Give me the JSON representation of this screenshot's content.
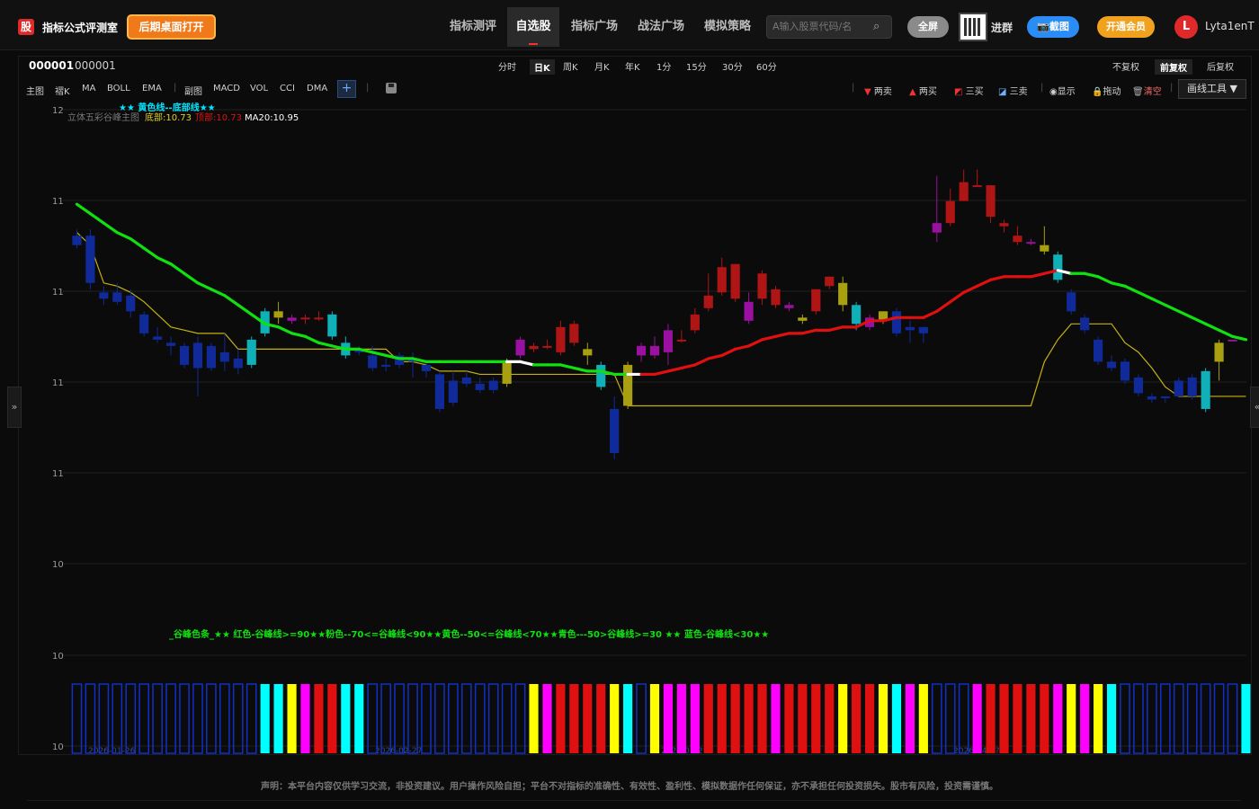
{
  "header": {
    "logo_badge": "股",
    "app_title": "指标公式评测室",
    "desktop_button": "后期桌面打开",
    "nav": [
      "指标测评",
      "自选股",
      "指标广场",
      "战法广场",
      "模拟策略"
    ],
    "active_nav": "自选股",
    "search_placeholder": "A输入股票代码/名",
    "fullscreen_button": "全屏",
    "join_group": "进群",
    "screenshot_button": "截图",
    "vip_button": "开通会员",
    "avatar_letter": "L",
    "username": "Lyta1enT",
    "colors": {
      "fullscreen": "#888888",
      "screenshot": "#2a8cf5",
      "vip": "#f0a21e",
      "avatar": "#e02a2a"
    }
  },
  "stock": {
    "code": "000001",
    "name": "000001"
  },
  "periods": [
    "分时",
    "日K",
    "周K",
    "月K",
    "年K",
    "1分",
    "15分",
    "30分",
    "60分"
  ],
  "active_period": "日K",
  "adjust": [
    "不复权",
    "前复权",
    "后复权"
  ],
  "active_adjust": "前复权",
  "indicator_bar": [
    "主图",
    "褶K",
    "MA",
    "BOLL",
    "EMA",
    "副图",
    "MACD",
    "VOL",
    "CCI",
    "DMA"
  ],
  "tools": {
    "two_sell": "两卖",
    "two_buy": "两买",
    "three_buy": "三买",
    "three_sell": "三卖",
    "show": "显示",
    "drag": "拖动",
    "clear": "清空",
    "draw_tools": "画线工具 ▼"
  },
  "chart_data": {
    "type": "candlestick",
    "y_tick_labels": [
      "12",
      "11",
      "11",
      "11",
      "11",
      "10",
      "10",
      "10"
    ],
    "legend_top": "★★ 黄色线--底部线★★",
    "legend_series": {
      "name": "立体五彩谷峰主图",
      "bottom": "底部:10.73",
      "top": "顶部:10.73",
      "ma20": "MA20:10.95"
    },
    "band_caption": "_谷峰色条_★★ 红色-谷峰线>=90★★粉色--70<=谷峰线<90★★黄色--50<=谷峰线<70★★青色---50>谷峰线>=30 ★★ 蓝色-谷峰线<30★★",
    "x_date_labels": [
      "2026-01-26",
      "2026-02-27",
      "2026-03-2?",
      "2026-04-2?"
    ],
    "ylim": [
      9.98,
      12.0
    ],
    "candles": [
      {
        "o": 11.6,
        "h": 11.62,
        "l": 11.56,
        "c": 11.57,
        "col": "blue"
      },
      {
        "o": 11.6,
        "h": 11.62,
        "l": 11.43,
        "c": 11.45,
        "col": "blue"
      },
      {
        "o": 11.42,
        "h": 11.44,
        "l": 11.38,
        "c": 11.4,
        "col": "blue"
      },
      {
        "o": 11.42,
        "h": 11.45,
        "l": 11.38,
        "c": 11.39,
        "col": "blue"
      },
      {
        "o": 11.41,
        "h": 11.43,
        "l": 11.34,
        "c": 11.36,
        "col": "blue"
      },
      {
        "o": 11.35,
        "h": 11.36,
        "l": 11.28,
        "c": 11.29,
        "col": "blue"
      },
      {
        "o": 11.28,
        "h": 11.31,
        "l": 11.26,
        "c": 11.27,
        "col": "blue"
      },
      {
        "o": 11.26,
        "h": 11.28,
        "l": 11.22,
        "c": 11.25,
        "col": "blue"
      },
      {
        "o": 11.25,
        "h": 11.26,
        "l": 11.18,
        "c": 11.19,
        "col": "blue"
      },
      {
        "o": 11.26,
        "h": 11.28,
        "l": 11.09,
        "c": 11.18,
        "col": "blue"
      },
      {
        "o": 11.25,
        "h": 11.26,
        "l": 11.17,
        "c": 11.18,
        "col": "blue"
      },
      {
        "o": 11.23,
        "h": 11.29,
        "l": 11.17,
        "c": 11.2,
        "col": "blue"
      },
      {
        "o": 11.21,
        "h": 11.24,
        "l": 11.16,
        "c": 11.18,
        "col": "blue"
      },
      {
        "o": 11.19,
        "h": 11.28,
        "l": 11.18,
        "c": 11.27,
        "col": "cyan"
      },
      {
        "o": 11.29,
        "h": 11.37,
        "l": 11.28,
        "c": 11.36,
        "col": "cyan"
      },
      {
        "o": 11.34,
        "h": 11.39,
        "l": 11.32,
        "c": 11.36,
        "col": "yellow"
      },
      {
        "o": 11.34,
        "h": 11.35,
        "l": 11.32,
        "c": 11.33,
        "col": "pink"
      },
      {
        "o": 11.34,
        "h": 11.35,
        "l": 11.32,
        "c": 11.34,
        "col": "red"
      },
      {
        "o": 11.34,
        "h": 11.36,
        "l": 11.33,
        "c": 11.34,
        "col": "red"
      },
      {
        "o": 11.35,
        "h": 11.36,
        "l": 11.27,
        "c": 11.28,
        "col": "cyan"
      },
      {
        "o": 11.26,
        "h": 11.28,
        "l": 11.21,
        "c": 11.22,
        "col": "cyan"
      },
      {
        "o": 11.24,
        "h": 11.25,
        "l": 11.22,
        "c": 11.23,
        "col": "blue"
      },
      {
        "o": 11.22,
        "h": 11.25,
        "l": 11.17,
        "c": 11.18,
        "col": "blue"
      },
      {
        "o": 11.19,
        "h": 11.21,
        "l": 11.17,
        "c": 11.19,
        "col": "blue"
      },
      {
        "o": 11.22,
        "h": 11.23,
        "l": 11.18,
        "c": 11.19,
        "col": "blue"
      },
      {
        "o": 11.2,
        "h": 11.23,
        "l": 11.15,
        "c": 11.21,
        "col": "blue"
      },
      {
        "o": 11.19,
        "h": 11.2,
        "l": 11.15,
        "c": 11.17,
        "col": "blue"
      },
      {
        "o": 11.16,
        "h": 11.17,
        "l": 11.04,
        "c": 11.05,
        "col": "blue"
      },
      {
        "o": 11.14,
        "h": 11.17,
        "l": 11.06,
        "c": 11.07,
        "col": "blue"
      },
      {
        "o": 11.15,
        "h": 11.17,
        "l": 11.12,
        "c": 11.13,
        "col": "blue"
      },
      {
        "o": 11.13,
        "h": 11.15,
        "l": 11.1,
        "c": 11.11,
        "col": "blue"
      },
      {
        "o": 11.11,
        "h": 11.15,
        "l": 11.1,
        "c": 11.14,
        "col": "blue"
      },
      {
        "o": 11.13,
        "h": 11.21,
        "l": 11.12,
        "c": 11.2,
        "col": "yellow"
      },
      {
        "o": 11.22,
        "h": 11.28,
        "l": 11.21,
        "c": 11.27,
        "col": "pink"
      },
      {
        "o": 11.24,
        "h": 11.26,
        "l": 11.23,
        "c": 11.25,
        "col": "red"
      },
      {
        "o": 11.25,
        "h": 11.27,
        "l": 11.24,
        "c": 11.25,
        "col": "red"
      },
      {
        "o": 11.23,
        "h": 11.33,
        "l": 11.22,
        "c": 11.31,
        "col": "red"
      },
      {
        "o": 11.26,
        "h": 11.33,
        "l": 11.25,
        "c": 11.32,
        "col": "red"
      },
      {
        "o": 11.22,
        "h": 11.26,
        "l": 11.19,
        "c": 11.24,
        "col": "yellow"
      },
      {
        "o": 11.19,
        "h": 11.2,
        "l": 11.11,
        "c": 11.12,
        "col": "cyan"
      },
      {
        "o": 11.05,
        "h": 11.09,
        "l": 10.89,
        "c": 10.91,
        "col": "blue"
      },
      {
        "o": 11.06,
        "h": 11.2,
        "l": 11.05,
        "c": 11.19,
        "col": "yellow"
      },
      {
        "o": 11.22,
        "h": 11.26,
        "l": 11.2,
        "c": 11.25,
        "col": "pink"
      },
      {
        "o": 11.22,
        "h": 11.28,
        "l": 11.21,
        "c": 11.25,
        "col": "pink"
      },
      {
        "o": 11.23,
        "h": 11.32,
        "l": 11.19,
        "c": 11.3,
        "col": "pink"
      },
      {
        "o": 11.27,
        "h": 11.3,
        "l": 11.26,
        "c": 11.27,
        "col": "red"
      },
      {
        "o": 11.3,
        "h": 11.37,
        "l": 11.29,
        "c": 11.35,
        "col": "red"
      },
      {
        "o": 11.37,
        "h": 11.48,
        "l": 11.36,
        "c": 11.41,
        "col": "red"
      },
      {
        "o": 11.42,
        "h": 11.53,
        "l": 11.41,
        "c": 11.5,
        "col": "red"
      },
      {
        "o": 11.4,
        "h": 11.51,
        "l": 11.39,
        "c": 11.51,
        "col": "red"
      },
      {
        "o": 11.33,
        "h": 11.42,
        "l": 11.32,
        "c": 11.39,
        "col": "pink"
      },
      {
        "o": 11.4,
        "h": 11.49,
        "l": 11.38,
        "c": 11.48,
        "col": "red"
      },
      {
        "o": 11.38,
        "h": 11.44,
        "l": 11.37,
        "c": 11.43,
        "col": "red"
      },
      {
        "o": 11.38,
        "h": 11.39,
        "l": 11.36,
        "c": 11.37,
        "col": "pink"
      },
      {
        "o": 11.34,
        "h": 11.35,
        "l": 11.32,
        "c": 11.33,
        "col": "yellow"
      },
      {
        "o": 11.36,
        "h": 11.43,
        "l": 11.35,
        "c": 11.43,
        "col": "red"
      },
      {
        "o": 11.44,
        "h": 11.47,
        "l": 11.43,
        "c": 11.47,
        "col": "red"
      },
      {
        "o": 11.45,
        "h": 11.47,
        "l": 11.36,
        "c": 11.38,
        "col": "yellow"
      },
      {
        "o": 11.38,
        "h": 11.39,
        "l": 11.3,
        "c": 11.32,
        "col": "cyan"
      },
      {
        "o": 11.31,
        "h": 11.35,
        "l": 11.3,
        "c": 11.34,
        "col": "pink"
      },
      {
        "o": 11.33,
        "h": 11.36,
        "l": 11.32,
        "c": 11.36,
        "col": "yellow"
      },
      {
        "o": 11.36,
        "h": 11.37,
        "l": 11.28,
        "c": 11.29,
        "col": "blue"
      },
      {
        "o": 11.31,
        "h": 11.33,
        "l": 11.26,
        "c": 11.3,
        "col": "blue"
      },
      {
        "o": 11.31,
        "h": 11.31,
        "l": 11.26,
        "c": 11.29,
        "col": "blue"
      },
      {
        "o": 11.64,
        "h": 11.79,
        "l": 11.58,
        "c": 11.61,
        "col": "pink"
      },
      {
        "o": 11.71,
        "h": 11.75,
        "l": 11.63,
        "c": 11.64,
        "col": "red"
      },
      {
        "o": 11.77,
        "h": 11.81,
        "l": 11.71,
        "c": 11.71,
        "col": "red"
      },
      {
        "o": 11.76,
        "h": 11.81,
        "l": 11.76,
        "c": 11.76,
        "col": "red"
      },
      {
        "o": 11.76,
        "h": 11.76,
        "l": 11.64,
        "c": 11.66,
        "col": "red"
      },
      {
        "o": 11.63,
        "h": 11.65,
        "l": 11.61,
        "c": 11.64,
        "col": "red"
      },
      {
        "o": 11.6,
        "h": 11.63,
        "l": 11.57,
        "c": 11.58,
        "col": "red"
      },
      {
        "o": 11.58,
        "h": 11.59,
        "l": 11.57,
        "c": 11.58,
        "col": "pink"
      },
      {
        "o": 11.55,
        "h": 11.63,
        "l": 11.54,
        "c": 11.57,
        "col": "yellow"
      },
      {
        "o": 11.54,
        "h": 11.55,
        "l": 11.45,
        "c": 11.46,
        "col": "cyan"
      },
      {
        "o": 11.42,
        "h": 11.43,
        "l": 11.35,
        "c": 11.36,
        "col": "blue"
      },
      {
        "o": 11.34,
        "h": 11.35,
        "l": 11.29,
        "c": 11.3,
        "col": "blue"
      },
      {
        "o": 11.27,
        "h": 11.28,
        "l": 11.19,
        "c": 11.2,
        "col": "blue"
      },
      {
        "o": 11.2,
        "h": 11.22,
        "l": 11.17,
        "c": 11.18,
        "col": "blue"
      },
      {
        "o": 11.2,
        "h": 11.21,
        "l": 11.13,
        "c": 11.14,
        "col": "blue"
      },
      {
        "o": 11.15,
        "h": 11.16,
        "l": 11.09,
        "c": 11.1,
        "col": "blue"
      },
      {
        "o": 11.09,
        "h": 11.1,
        "l": 11.07,
        "c": 11.08,
        "col": "blue"
      },
      {
        "o": 11.09,
        "h": 11.09,
        "l": 11.07,
        "c": 11.09,
        "col": "blue"
      },
      {
        "o": 11.14,
        "h": 11.15,
        "l": 11.09,
        "c": 11.09,
        "col": "blue"
      },
      {
        "o": 11.15,
        "h": 11.16,
        "l": 11.08,
        "c": 11.09,
        "col": "blue"
      },
      {
        "o": 11.05,
        "h": 11.18,
        "l": 11.04,
        "c": 11.17,
        "col": "cyan"
      },
      {
        "o": 11.2,
        "h": 11.27,
        "l": 11.14,
        "c": 11.26,
        "col": "yellow"
      },
      {
        "o": 11.27,
        "h": 11.27,
        "l": 11.27,
        "c": 11.27,
        "col": "pink"
      }
    ],
    "ma20_curve": [
      11.7,
      11.67,
      11.64,
      11.61,
      11.59,
      11.56,
      11.53,
      11.51,
      11.48,
      11.45,
      11.43,
      11.41,
      11.38,
      11.35,
      11.32,
      11.31,
      11.29,
      11.28,
      11.26,
      11.25,
      11.24,
      11.24,
      11.23,
      11.22,
      11.21,
      11.21,
      11.2,
      11.2,
      11.2,
      11.2,
      11.2,
      11.2,
      11.2,
      11.2,
      11.19,
      11.19,
      11.19,
      11.18,
      11.17,
      11.17,
      11.16,
      11.16,
      11.16,
      11.16,
      11.17,
      11.18,
      11.19,
      11.21,
      11.22,
      11.24,
      11.25,
      11.27,
      11.28,
      11.29,
      11.29,
      11.3,
      11.3,
      11.31,
      11.31,
      11.33,
      11.33,
      11.34,
      11.34,
      11.34,
      11.36,
      11.39,
      11.42,
      11.44,
      11.46,
      11.47,
      11.47,
      11.47,
      11.48,
      11.49,
      11.48,
      11.48,
      11.47,
      11.45,
      11.44,
      11.42,
      11.4,
      11.38,
      11.36,
      11.34,
      11.32,
      11.3,
      11.28,
      11.27
    ],
    "ma20_colors": [
      "green",
      "green",
      "green",
      "green",
      "green",
      "green",
      "green",
      "green",
      "green",
      "green",
      "green",
      "green",
      "green",
      "green",
      "green",
      "green",
      "green",
      "green",
      "green",
      "green",
      "green",
      "green",
      "green",
      "green",
      "green",
      "green",
      "green",
      "green",
      "green",
      "green",
      "green",
      "green",
      "white",
      "white",
      "green",
      "green",
      "green",
      "green",
      "green",
      "green",
      "green",
      "white",
      "red",
      "red",
      "red",
      "red",
      "red",
      "red",
      "red",
      "red",
      "red",
      "red",
      "red",
      "red",
      "red",
      "red",
      "red",
      "red",
      "red",
      "red",
      "red",
      "red",
      "red",
      "red",
      "red",
      "red",
      "red",
      "red",
      "red",
      "red",
      "red",
      "red",
      "red",
      "white",
      "green",
      "green",
      "green",
      "green",
      "green",
      "green",
      "green",
      "green",
      "green",
      "green",
      "green",
      "green",
      "green",
      "green"
    ],
    "bottom_line": [
      11.61,
      11.57,
      11.45,
      11.44,
      11.42,
      11.39,
      11.35,
      11.31,
      11.3,
      11.29,
      11.29,
      11.29,
      11.24,
      11.24,
      11.24,
      11.24,
      11.24,
      11.24,
      11.24,
      11.24,
      11.24,
      11.24,
      11.24,
      11.24,
      11.2,
      11.2,
      11.19,
      11.17,
      11.17,
      11.17,
      11.16,
      11.16,
      11.16,
      11.16,
      11.16,
      11.16,
      11.16,
      11.16,
      11.16,
      11.16,
      11.16,
      11.06,
      11.06,
      11.06,
      11.06,
      11.06,
      11.06,
      11.06,
      11.06,
      11.06,
      11.06,
      11.06,
      11.06,
      11.06,
      11.06,
      11.06,
      11.06,
      11.06,
      11.06,
      11.06,
      11.06,
      11.06,
      11.06,
      11.06,
      11.06,
      11.06,
      11.06,
      11.06,
      11.06,
      11.06,
      11.06,
      11.06,
      11.2,
      11.27,
      11.32,
      11.32,
      11.32,
      11.32,
      11.26,
      11.23,
      11.18,
      11.12,
      11.09,
      11.09,
      11.09,
      11.09,
      11.09,
      11.09
    ],
    "color_band": [
      "blue",
      "blue",
      "blue",
      "blue",
      "blue",
      "blue",
      "blue",
      "blue",
      "blue",
      "blue",
      "blue",
      "blue",
      "blue",
      "blue",
      "cyan",
      "cyan",
      "yellow",
      "pink",
      "red",
      "red",
      "cyan",
      "cyan",
      "blue",
      "blue",
      "blue",
      "blue",
      "blue",
      "blue",
      "blue",
      "blue",
      "blue",
      "blue",
      "blue",
      "blue",
      "yellow",
      "pink",
      "red",
      "red",
      "red",
      "red",
      "yellow",
      "cyan",
      "blue",
      "yellow",
      "pink",
      "pink",
      "pink",
      "red",
      "red",
      "red",
      "red",
      "red",
      "pink",
      "red",
      "red",
      "red",
      "red",
      "yellow",
      "red",
      "red",
      "yellow",
      "cyan",
      "pink",
      "yellow",
      "blue",
      "blue",
      "blue",
      "pink",
      "red",
      "red",
      "red",
      "red",
      "red",
      "pink",
      "yellow",
      "pink",
      "yellow",
      "cyan",
      "blue",
      "blue",
      "blue",
      "blue",
      "blue",
      "blue",
      "blue",
      "blue",
      "blue",
      "cyan",
      "yellow",
      "pink"
    ],
    "palette": {
      "red": "#e01010",
      "pink": "#ff00ff",
      "yellow": "#ffff00",
      "cyan": "#00ffff",
      "blue": "#1030c8",
      "green": "#10e010",
      "white": "#ffffff",
      "bottom": "#c8b010"
    },
    "candle_palette": {
      "red": "#b01515",
      "pink": "#9a10a0",
      "yellow": "#a8a010",
      "cyan": "#10b0b8",
      "blue": "#102a9a"
    }
  },
  "disclaimer": "声明：本平台内容仅供学习交流，非投资建议。用户操作风险自担；平台不对指标的准确性、有效性、盈利性、模拟数据作任何保证，亦不承担任何投资损失。股市有风险，投资需谨慎。",
  "side_tabs": {
    "left": "»",
    "right": "«"
  }
}
